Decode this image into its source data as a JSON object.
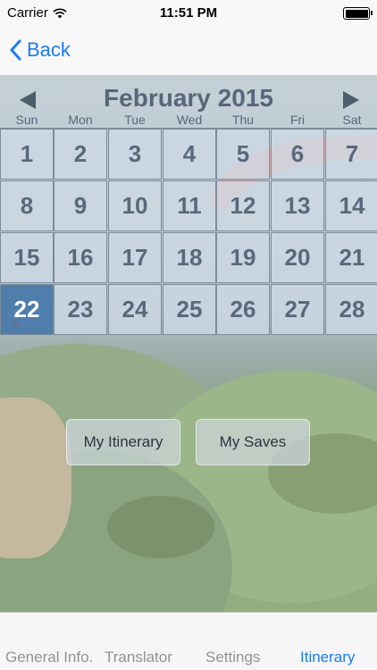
{
  "status_bar": {
    "carrier": "Carrier",
    "time": "11:51 PM"
  },
  "nav": {
    "back_label": "Back"
  },
  "calendar": {
    "month_label": "February 2015",
    "weekdays": [
      "Sun",
      "Mon",
      "Tue",
      "Wed",
      "Thu",
      "Fri",
      "Sat"
    ],
    "days": [
      "1",
      "2",
      "3",
      "4",
      "5",
      "6",
      "7",
      "8",
      "9",
      "10",
      "11",
      "12",
      "13",
      "14",
      "15",
      "16",
      "17",
      "18",
      "19",
      "20",
      "21",
      "22",
      "23",
      "24",
      "25",
      "26",
      "27",
      "28"
    ],
    "selected_day": "22"
  },
  "buttons": {
    "itinerary": "My Itinerary",
    "saves": "My Saves"
  },
  "tabs": [
    "General Info.",
    "Translator",
    "Settings",
    "Itinerary"
  ],
  "active_tab": "Itinerary",
  "colors": {
    "accent": "#1a7cf2",
    "today_cell": "#4f7eaa",
    "calendar_text": "#56677a"
  }
}
